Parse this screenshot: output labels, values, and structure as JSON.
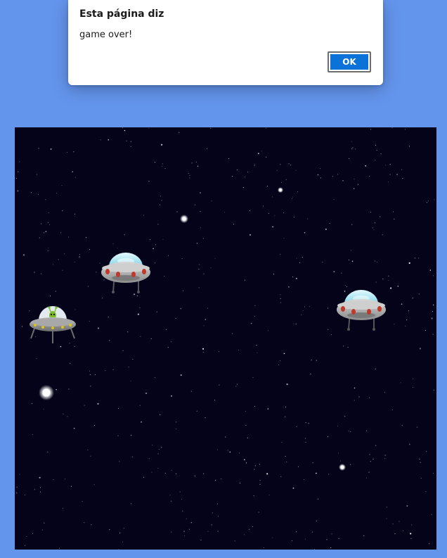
{
  "dialog": {
    "title": "Esta página diz",
    "message": "game over!",
    "ok_label": "OK"
  },
  "game": {
    "background_color": "#04031a",
    "page_background_color": "#6495ED",
    "entities": [
      {
        "type": "player-ufo-with-alien",
        "icon": "ufo-alien-icon"
      },
      {
        "type": "enemy-ufo",
        "icon": "ufo-icon"
      },
      {
        "type": "enemy-ufo",
        "icon": "ufo-icon"
      },
      {
        "type": "bright-star",
        "icon": "star-icon"
      },
      {
        "type": "bright-star",
        "icon": "star-icon"
      },
      {
        "type": "bright-star",
        "icon": "star-icon"
      },
      {
        "type": "bright-star",
        "icon": "star-icon"
      }
    ]
  }
}
